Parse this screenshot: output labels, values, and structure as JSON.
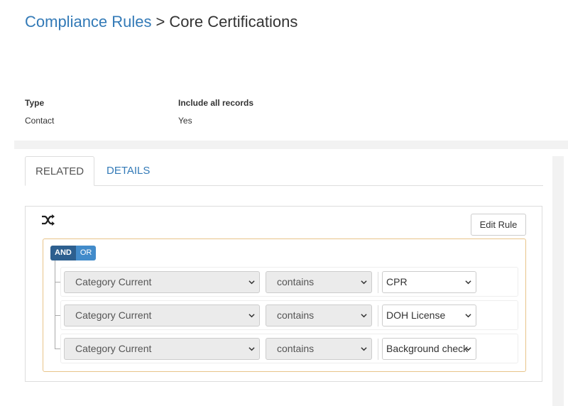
{
  "breadcrumb": {
    "parent": "Compliance Rules",
    "separator": ">",
    "current": "Core Certifications"
  },
  "info": {
    "type_label": "Type",
    "type_value": "Contact",
    "include_label": "Include all records",
    "include_value": "Yes"
  },
  "tabs": [
    {
      "label": "RELATED",
      "active": true
    },
    {
      "label": "DETAILS",
      "active": false
    }
  ],
  "panel": {
    "icon": "shuffle-icon",
    "edit_rule_label": "Edit Rule",
    "conjunction": {
      "and_label": "AND",
      "or_label": "OR",
      "selected": "AND"
    },
    "rules": [
      {
        "field": "Category Current",
        "operator": "contains",
        "value": "CPR"
      },
      {
        "field": "Category Current",
        "operator": "contains",
        "value": "DOH License"
      },
      {
        "field": "Category Current",
        "operator": "contains",
        "value": "Background check"
      }
    ]
  },
  "colors": {
    "link": "#337ab7",
    "and_active": "#2d5f8f",
    "or_inactive": "#428bca",
    "group_border": "#e8c48a"
  }
}
